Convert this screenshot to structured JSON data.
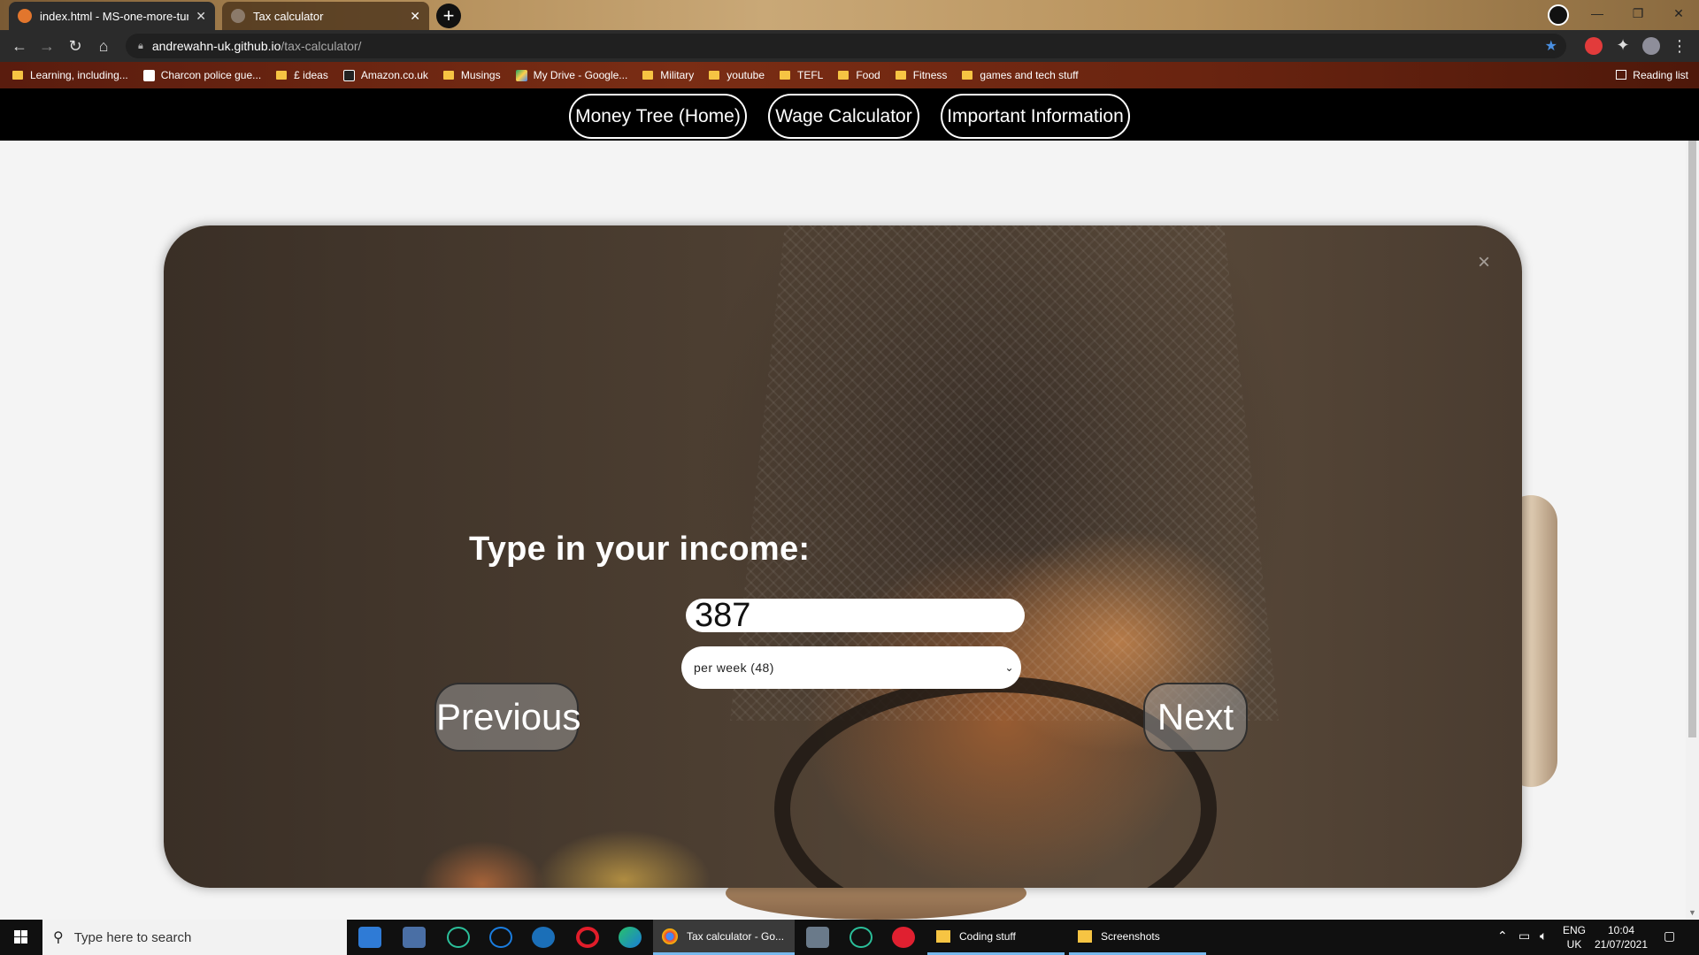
{
  "browser": {
    "tabs": [
      {
        "title": "index.html - MS-one-more-turn",
        "active": true
      },
      {
        "title": "Tax calculator",
        "active": false
      }
    ],
    "url_domain": "andrewahn-uk.github.io",
    "url_path": "/tax-calculator/",
    "bookmarks": [
      {
        "label": "Learning, including...",
        "icon": "folder"
      },
      {
        "label": "Charcon police gue...",
        "icon": "site"
      },
      {
        "label": "£ ideas",
        "icon": "folder"
      },
      {
        "label": "Amazon.co.uk",
        "icon": "site"
      },
      {
        "label": "Musings",
        "icon": "folder"
      },
      {
        "label": "My Drive - Google...",
        "icon": "drive"
      },
      {
        "label": "Military",
        "icon": "folder"
      },
      {
        "label": "youtube",
        "icon": "folder"
      },
      {
        "label": "TEFL",
        "icon": "folder"
      },
      {
        "label": "Food",
        "icon": "folder"
      },
      {
        "label": "Fitness",
        "icon": "folder"
      },
      {
        "label": "games and tech stuff",
        "icon": "folder"
      }
    ],
    "reading_list": "Reading list"
  },
  "page": {
    "nav": [
      "Money Tree (Home)",
      "Wage Calculator",
      "Important Information"
    ],
    "modal": {
      "close": "×",
      "prompt": "Type in your income:",
      "income_value": "387",
      "period_selected": "per week (48)",
      "previous": "Previous",
      "next": "Next"
    }
  },
  "taskbar": {
    "search_placeholder": "Type here to search",
    "tasks": [
      "Tax calculator - Go...",
      "Coding stuff",
      "Screenshots"
    ],
    "lang": [
      "ENG",
      "UK"
    ],
    "time": "10:04",
    "date": "21/07/2021"
  }
}
